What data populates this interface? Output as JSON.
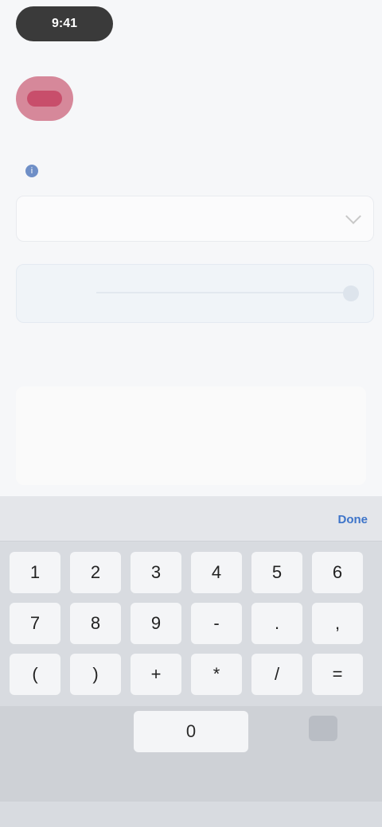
{
  "status": {
    "time": "9:41",
    "right": ""
  },
  "header": {
    "title": "",
    "subtitle": ""
  },
  "form": {
    "label": "",
    "info_icon": "info-icon",
    "field1_value": "",
    "field2_value": "",
    "helper_text": "",
    "helper_link": ""
  },
  "card": {
    "lines": [
      "",
      "",
      "",
      ""
    ]
  },
  "keyboard": {
    "done_label": "Done",
    "rows": [
      [
        "1",
        "2",
        "3",
        "4",
        "5",
        "6"
      ],
      [
        "7",
        "8",
        "9",
        "-",
        ".",
        ","
      ],
      [
        "(",
        ")",
        "+",
        "*",
        "/",
        "="
      ]
    ],
    "zero": "0"
  },
  "colors": {
    "accent": "#3d74c9",
    "logo": "#c84e6b"
  }
}
